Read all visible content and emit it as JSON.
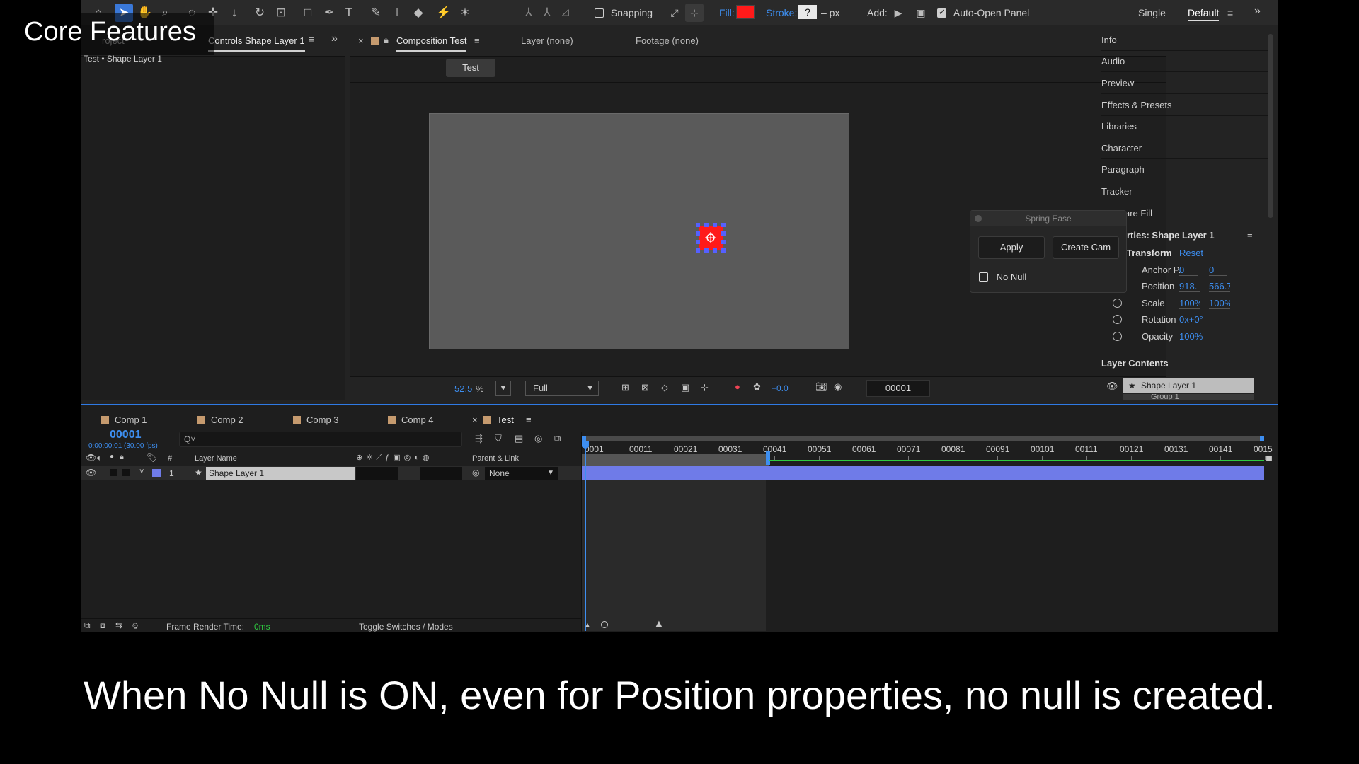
{
  "overlay": {
    "title": "Core Features",
    "caption": "When No Null is ON, even for Position properties, no null is created."
  },
  "toolbar": {
    "snapping_label": "Snapping",
    "fill_label": "Fill:",
    "fill_color": "#ff1a1a",
    "stroke_label": "Stroke:",
    "stroke_value": "?",
    "stroke_unit": "– px",
    "add_label": "Add:",
    "auto_open_label": "Auto-Open Panel",
    "workspace_single": "Single",
    "workspace_default": "Default"
  },
  "left_panel": {
    "tab_project": "roject",
    "tab_effect_controls": "Controls Shape Layer 1",
    "breadcrumb": "Test • Shape Layer 1"
  },
  "comp_panel": {
    "tab_composition": "Composition Test",
    "tab_layer": "Layer (none)",
    "tab_footage": "Footage (none)",
    "comp_button": "Test",
    "zoom_value": "52.5",
    "zoom_unit": "%",
    "resolution": "Full",
    "exposure": "+0.0",
    "timecode": "00001"
  },
  "right_panel": {
    "items": [
      "Info",
      "Audio",
      "Preview",
      "Effects & Presets",
      "Libraries",
      "Character",
      "Paragraph",
      "Tracker",
      "nt-Aware Fill"
    ],
    "properties_title": "rties: Shape Layer 1",
    "transform_label": "Transform",
    "reset_label": "Reset",
    "props": [
      {
        "label": "Anchor P.",
        "v1": "0",
        "v2": "0"
      },
      {
        "label": "Position",
        "v1": "918.",
        "v2": "566.7"
      },
      {
        "label": "Scale",
        "v1": "100%",
        "v2": "100%"
      },
      {
        "label": "Rotation",
        "v1": "0x+0°",
        "v2": ""
      },
      {
        "label": "Opacity",
        "v1": "100%",
        "v2": ""
      }
    ],
    "layer_contents_label": "Layer Contents",
    "layer_contents_item": "Shape Layer 1",
    "layer_contents_sub": "Group 1"
  },
  "spring_ease": {
    "title": "Spring Ease",
    "apply_label": "Apply",
    "create_cam_label": "Create Cam",
    "no_null_label": "No Null"
  },
  "timeline": {
    "tabs": [
      "Comp 1",
      "Comp 2",
      "Comp 3",
      "Comp 4",
      "Test"
    ],
    "current_time": "00001",
    "current_time_sub": "0:00:00:01 (30.00 fps)",
    "search_placeholder": "Q˅",
    "col_layer_name": "Layer Name",
    "col_parent": "Parent & Link",
    "col_num": "#",
    "layer": {
      "index": "1",
      "name": "Shape Layer 1",
      "parent": "None"
    },
    "ruler": [
      "0001",
      "00011",
      "00021",
      "00031",
      "00041",
      "00051",
      "00061",
      "00071",
      "00081",
      "00091",
      "00101",
      "00111",
      "00121",
      "00131",
      "00141",
      "0015"
    ],
    "frame_render_label": "Frame Render Time:",
    "frame_render_value": "0ms",
    "toggle_label": "Toggle Switches / Modes"
  }
}
